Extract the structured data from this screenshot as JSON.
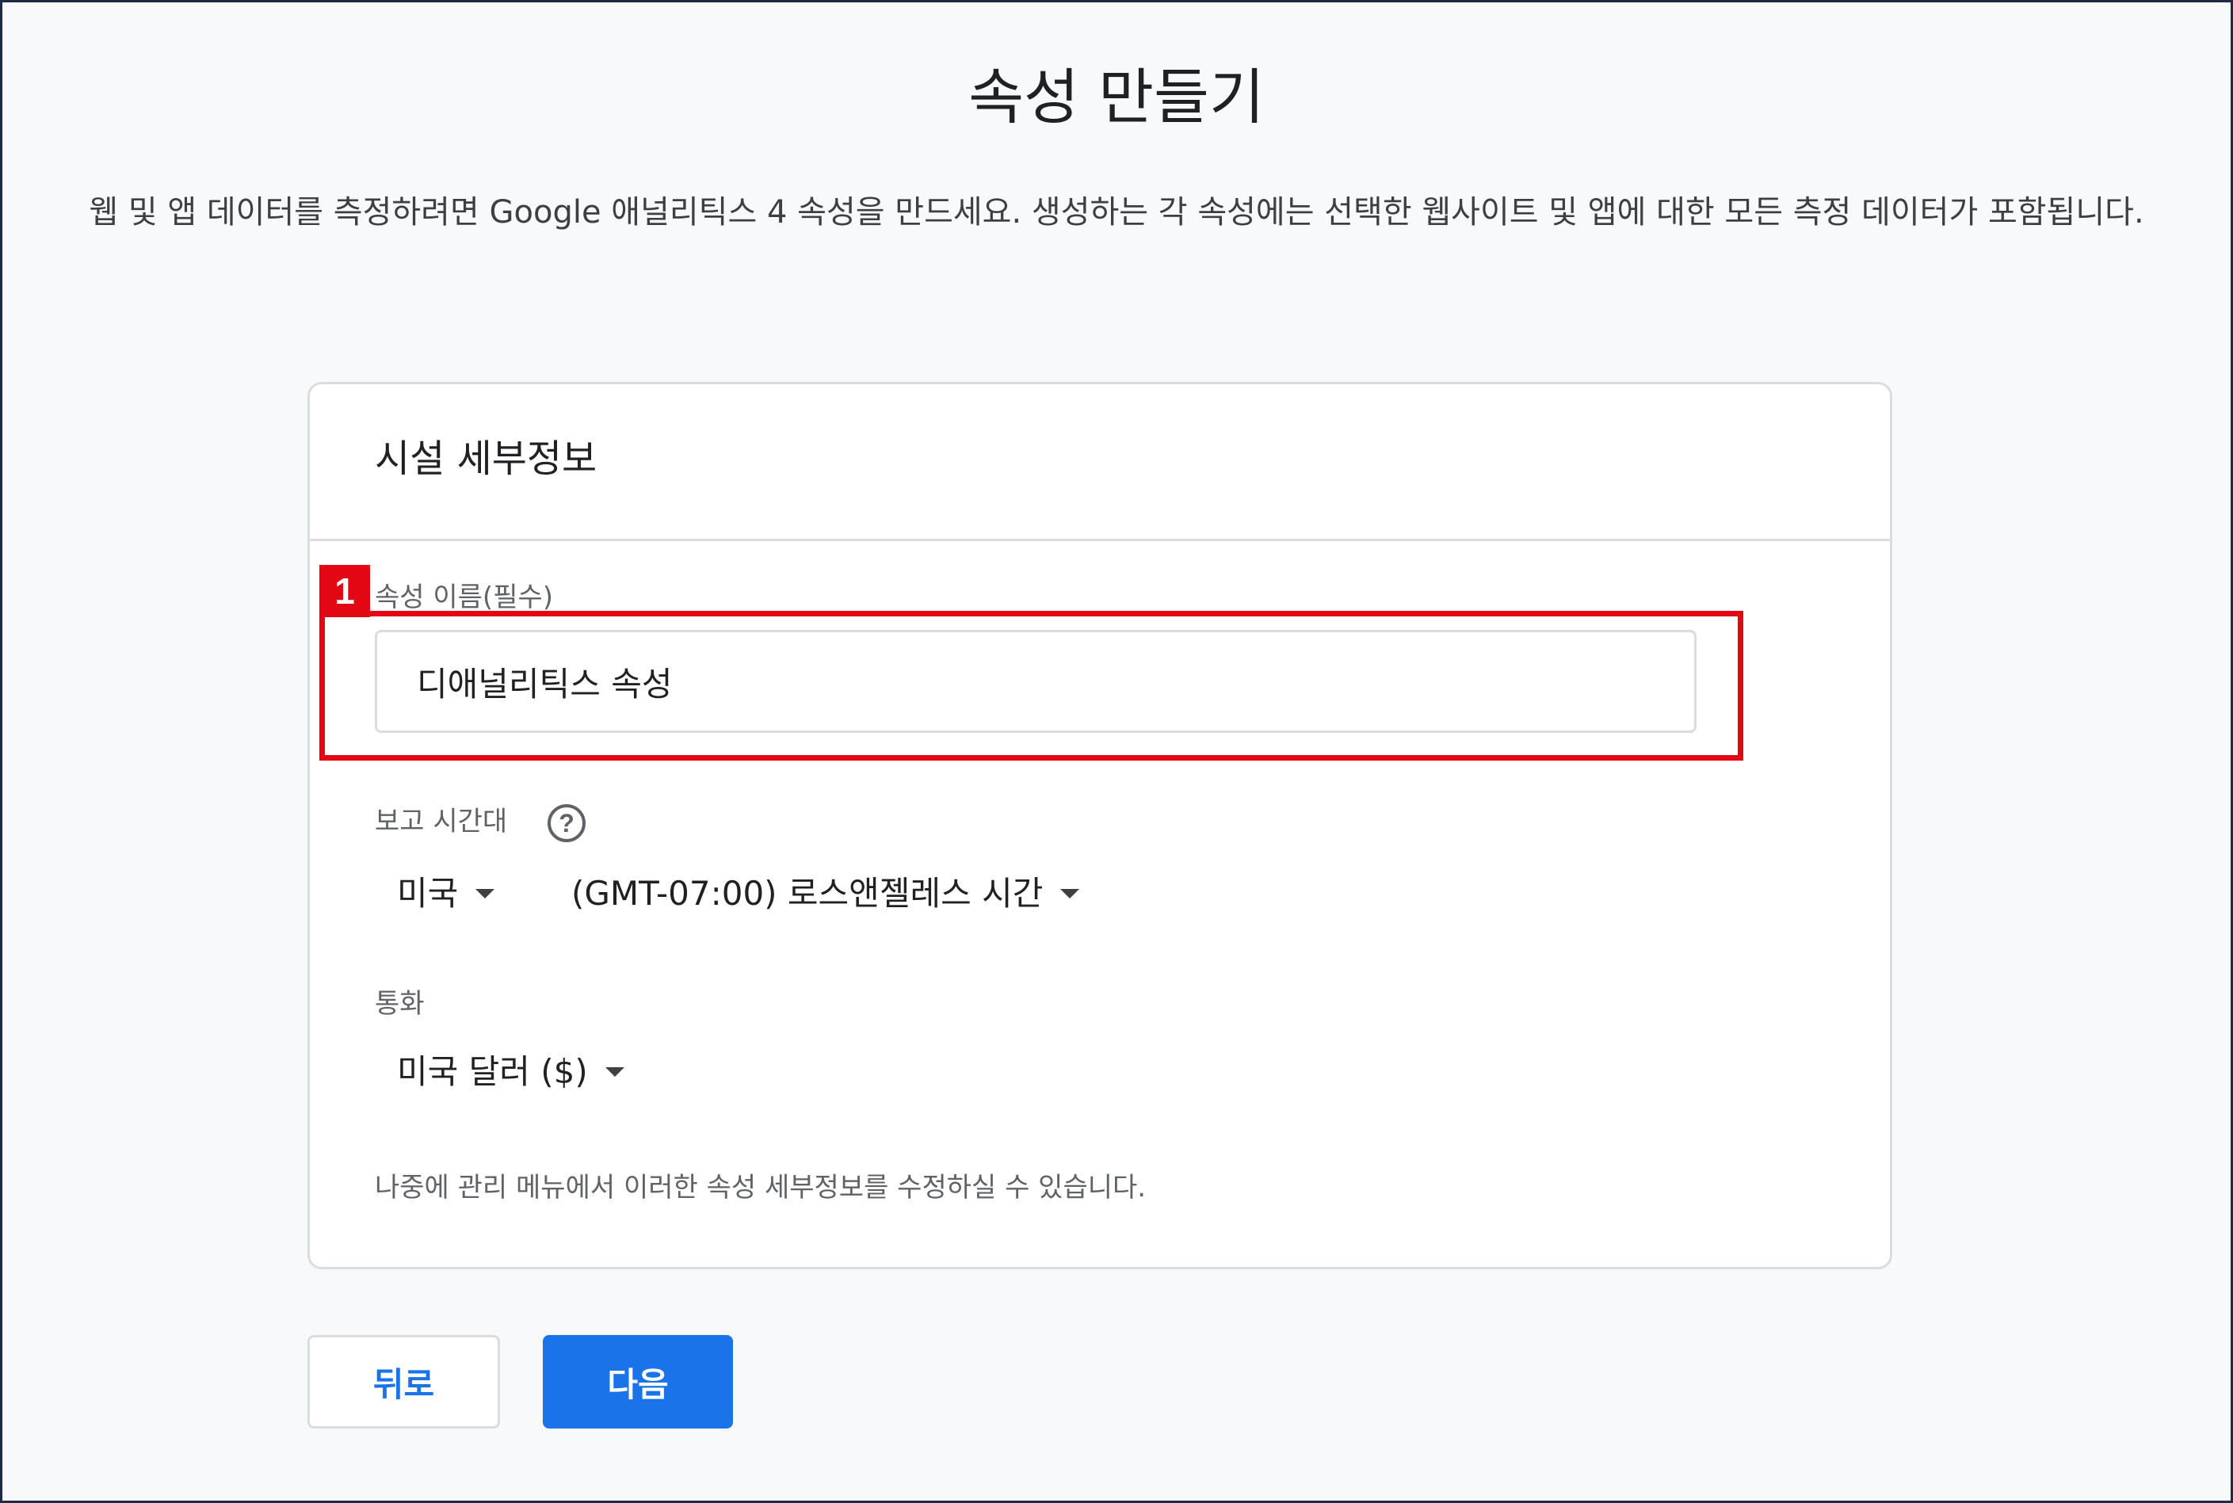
{
  "page": {
    "title": "속성 만들기",
    "description": "웹 및 앱 데이터를 측정하려면 Google 애널리틱스 4 속성을 만드세요. 생성하는 각 속성에는 선택한 웹사이트 및 앱에 대한 모든 측정 데이터가 포함됩니다."
  },
  "card": {
    "title": "시설 세부정보",
    "property_name": {
      "label": "속성 이름(필수)",
      "value": "디애널리틱스 속성"
    },
    "timezone": {
      "label": "보고 시간대",
      "help_icon": "help-circle-icon",
      "country": "미국",
      "zone": "(GMT-07:00) 로스앤젤레스 시간"
    },
    "currency": {
      "label": "통화",
      "value": "미국 달러 ($)"
    },
    "note": "나중에 관리 메뉴에서 이러한 속성 세부정보를 수정하실 수 있습니다."
  },
  "annotation": {
    "badge": "1",
    "color": "#e30613"
  },
  "buttons": {
    "back": "뒤로",
    "next": "다음"
  },
  "colors": {
    "primary": "#1a73e8",
    "border": "#dadce0"
  }
}
